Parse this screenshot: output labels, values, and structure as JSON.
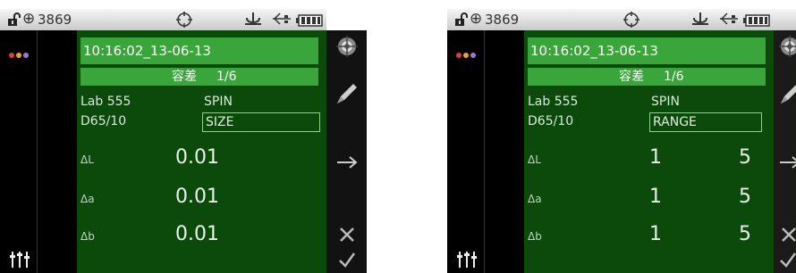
{
  "status_bar": {
    "serial": "3869"
  },
  "screens": [
    {
      "timestamp": "10:16:02_13-06-13",
      "tolerance_label": "容差",
      "tolerance_page": "1/6",
      "color_space": "Lab 555",
      "illuminant": "D65/10",
      "spin_label": "SPIN",
      "mode_value": "SIZE",
      "rows": [
        {
          "label": "ΔL",
          "value": "0.01"
        },
        {
          "label": "Δa",
          "value": "0.01"
        },
        {
          "label": "Δb",
          "value": "0.01"
        }
      ]
    },
    {
      "timestamp": "10:16:02_13-06-13",
      "tolerance_label": "容差",
      "tolerance_page": "1/6",
      "color_space": "Lab 555",
      "illuminant": "D65/10",
      "spin_label": "SPIN",
      "mode_value": "RANGE",
      "rows": [
        {
          "label": "ΔL",
          "min": "1",
          "max": "5"
        },
        {
          "label": "Δa",
          "min": "1",
          "max": "5"
        },
        {
          "label": "Δb",
          "min": "1",
          "max": "5"
        }
      ]
    }
  ],
  "icons": {
    "lock": "lock-open-icon",
    "target": "target-icon",
    "crosshair": "crosshair-icon",
    "usb": "usb-icon",
    "plug": "plug-icon",
    "battery": "battery-icon",
    "dots": "color-dots-icon",
    "equalizer": "equalizer-icon",
    "aperture": "aperture-icon",
    "edit": "pencil-icon",
    "next": "arrow-right-icon",
    "cancel": "close-icon",
    "confirm": "check-icon"
  },
  "colors": {
    "highlight": "#3aa53a",
    "panel": "#0c4a0c",
    "status_bar": "#d9d9d9"
  }
}
